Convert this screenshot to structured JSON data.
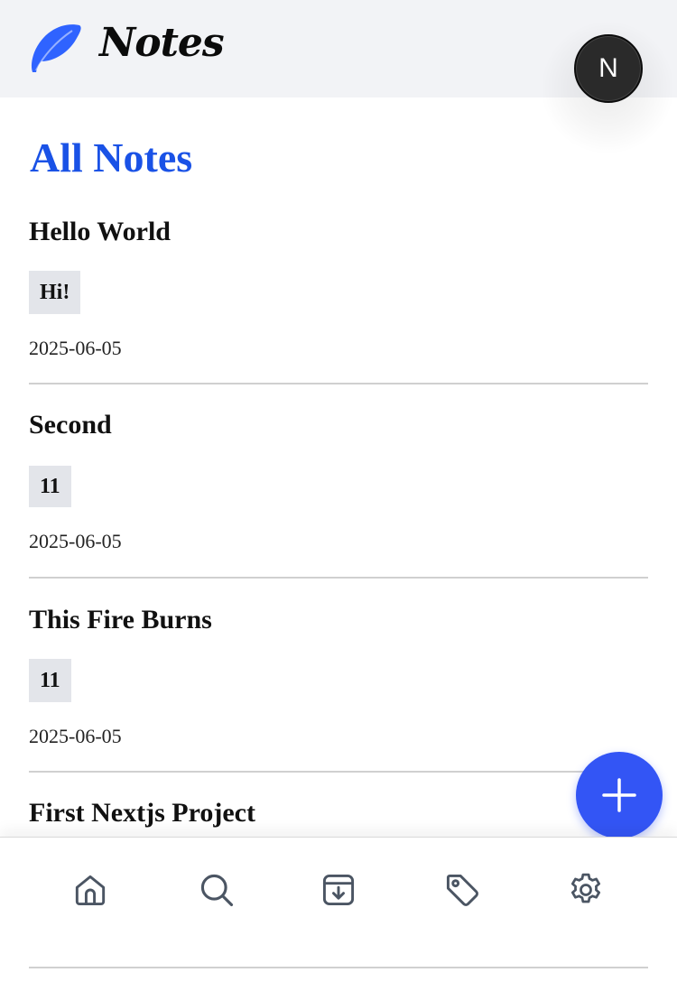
{
  "header": {
    "app_title": "Notes",
    "logo_icon": "feather-icon",
    "avatar_initial": "N"
  },
  "main": {
    "page_title": "All Notes",
    "notes": [
      {
        "title": "Hello World",
        "tag": "Hi!",
        "date": "2025-06-05"
      },
      {
        "title": "Second",
        "tag": "11",
        "date": "2025-06-05"
      },
      {
        "title": "This Fire Burns",
        "tag": "11",
        "date": "2025-06-05"
      },
      {
        "title": "First Nextjs Project"
      }
    ]
  },
  "fab": {
    "icon": "plus-icon"
  },
  "bottom_nav": {
    "items": [
      {
        "icon": "home-icon"
      },
      {
        "icon": "search-icon"
      },
      {
        "icon": "archive-download-icon"
      },
      {
        "icon": "tag-icon"
      },
      {
        "icon": "settings-gear-icon"
      }
    ]
  },
  "colors": {
    "accent": "#1a52e6",
    "fab": "#3355f5",
    "header_bg": "#f2f3f6",
    "tag_bg": "#e3e5ea",
    "nav_icon": "#4b5563"
  }
}
